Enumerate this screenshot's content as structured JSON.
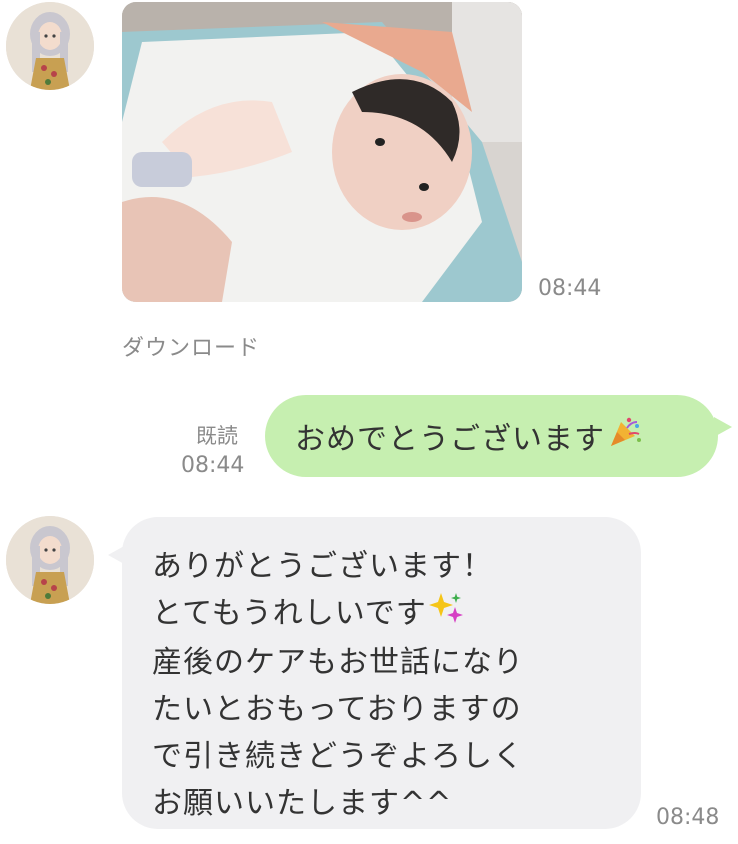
{
  "messages": {
    "incoming_photo": {
      "time": "08:44",
      "download_label": "ダウンロード"
    },
    "outgoing": {
      "read_label": "既読",
      "time": "08:44",
      "text": "おめでとうございます",
      "emoji": "party-popper-icon"
    },
    "incoming_text": {
      "lines": [
        "ありがとうございます！",
        "とてもうれしいです",
        "産後のケアもお世話になり",
        "たいとおもっておりますの",
        "で引き続きどうぞよろしく",
        "お願いいたします^^"
      ],
      "line2_emoji": "sparkles-icon",
      "time": "08:48"
    }
  },
  "colors": {
    "outgoing_bubble": "#c6efb0",
    "incoming_bubble": "#f0f0f2",
    "meta_text": "#8a8a8a"
  }
}
